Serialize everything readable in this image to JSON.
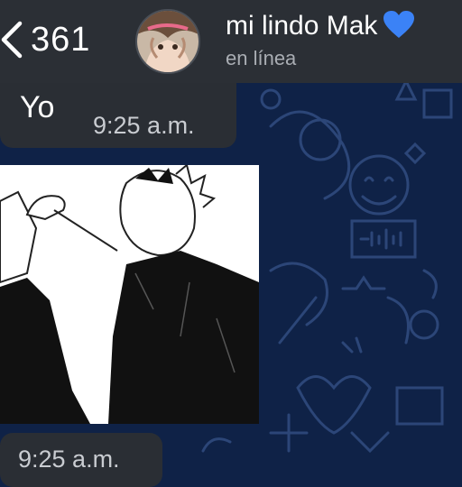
{
  "header": {
    "back_count": "361",
    "contact_name": "mi lindo Mak",
    "status": "en línea",
    "heart_color": "#3b82f6"
  },
  "messages": [
    {
      "text": "Yo",
      "time": "9:25 a.m."
    },
    {
      "type": "image",
      "description": ""
    },
    {
      "time": "9:25 a.m."
    }
  ],
  "colors": {
    "header_bg": "#2b2f35",
    "wallpaper_bg": "#0f2247",
    "bubble_bg": "#2a2e34"
  }
}
